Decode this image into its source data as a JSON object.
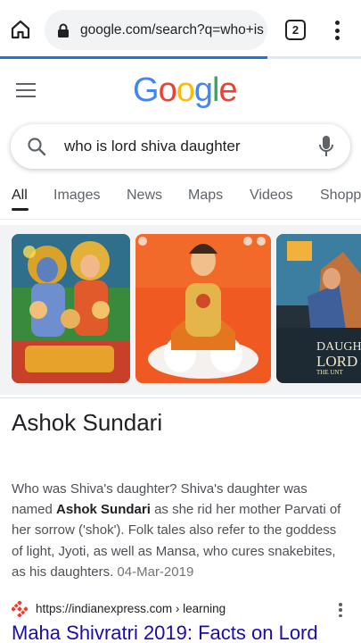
{
  "browser": {
    "url": "google.com/search?q=who+is",
    "tab_count": "2",
    "load_progress_percent": 74
  },
  "google": {
    "logo_letters": [
      {
        "char": "G",
        "color": "#4285F4"
      },
      {
        "char": "o",
        "color": "#EA4335"
      },
      {
        "char": "o",
        "color": "#FBBC05"
      },
      {
        "char": "g",
        "color": "#4285F4"
      },
      {
        "char": "l",
        "color": "#34A853"
      },
      {
        "char": "e",
        "color": "#EA4335"
      }
    ]
  },
  "search": {
    "query": "who is lord shiva daughter"
  },
  "tabs": {
    "all": "All",
    "images": "Images",
    "news": "News",
    "maps": "Maps",
    "videos": "Videos",
    "shopping": "Shopp"
  },
  "image_results": {
    "third_caption_line1": "DAUGH",
    "third_caption_line2": "LORD",
    "third_caption_line3": "THE UNT"
  },
  "answer": {
    "title": "Ashok Sundari",
    "snippet_part1": "Who was Shiva's daughter? Shiva's daughter was named ",
    "snippet_bold1": "Ashok Sundari",
    "snippet_part2": " as she rid her mother Parvati of her sorrow ('shok'). Folk tales also refer to the goddess of light, Jyoti, as well as Mansa, who cures snakebites, as his daughters.",
    "snippet_date": "04-Mar-2019"
  },
  "source": {
    "url": "https://indianexpress.com › learning",
    "result_title": "Maha Shivratri 2019: Facts on Lord"
  },
  "colors": {
    "accent": "#1a73e8",
    "link": "#1a0dab",
    "favicon": "#e84133"
  }
}
